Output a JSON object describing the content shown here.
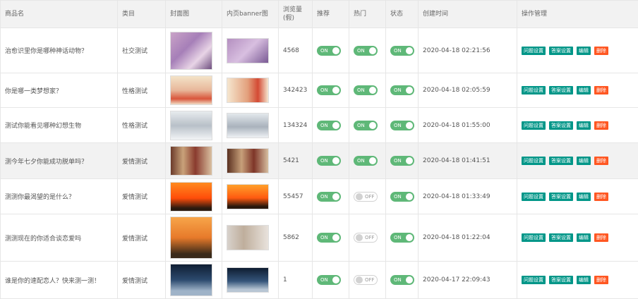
{
  "headers": {
    "name": "商品名",
    "category": "类目",
    "cover": "封面图",
    "banner": "内页banner图",
    "views": "浏览量\n(假)",
    "recommend": "推荐",
    "hot": "热门",
    "status": "状态",
    "created": "创建时间",
    "actions": "操作管理"
  },
  "switch_on": "ON",
  "switch_off": "OFF",
  "actions": {
    "question": "问题设置",
    "answer": "答案设置",
    "edit": "编辑",
    "delete": "删除"
  },
  "colors": {
    "switch_on": "#5fb878",
    "action_button": "#009688",
    "delete_button": "#ff5722"
  },
  "rows": [
    {
      "name": "治愈识里你是哪种神话动物？",
      "category": "社交测试",
      "views": "4568",
      "recommend": true,
      "hot": true,
      "status": true,
      "created": "2020-04-18 02:21:56"
    },
    {
      "name": "你是哪一类梦想家？",
      "category": "性格测试",
      "views": "342423",
      "recommend": true,
      "hot": true,
      "status": true,
      "created": "2020-04-18 02:05:59"
    },
    {
      "name": "测试你能看见哪种幻想生物",
      "category": "性格测试",
      "views": "134324",
      "recommend": true,
      "hot": true,
      "status": true,
      "created": "2020-04-18 01:55:00"
    },
    {
      "name": "测今年七夕你能成功脱单吗？",
      "category": "爱情测试",
      "views": "5421",
      "recommend": true,
      "hot": true,
      "status": true,
      "created": "2020-04-18 01:41:51"
    },
    {
      "name": "测测你最渴望的是什么？",
      "category": "爱情测试",
      "views": "55457",
      "recommend": true,
      "hot": false,
      "status": true,
      "created": "2020-04-18 01:33:49"
    },
    {
      "name": "测测现在的你适合谈恋爱吗",
      "category": "爱情测试",
      "views": "5862",
      "recommend": true,
      "hot": false,
      "status": true,
      "created": "2020-04-18 01:22:04"
    },
    {
      "name": "谁是你的速配恋人？快来测一测！",
      "category": "爱情测试",
      "views": "1",
      "recommend": true,
      "hot": false,
      "status": true,
      "created": "2020-04-17 22:09:43"
    }
  ]
}
